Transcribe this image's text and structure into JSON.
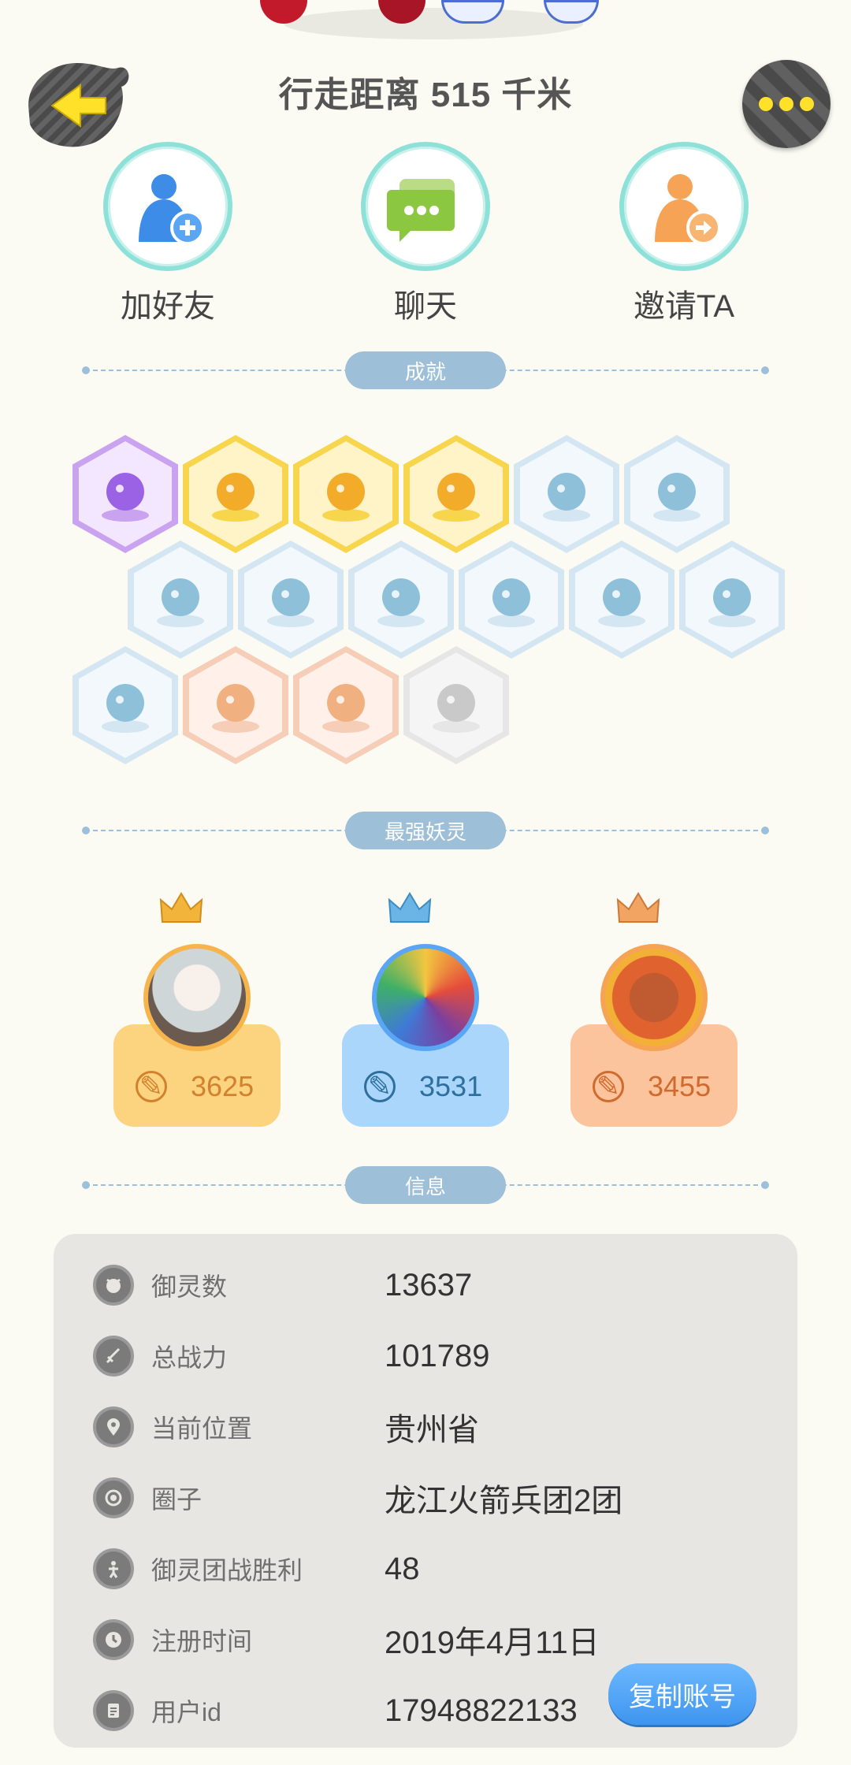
{
  "header": {
    "distance": "行走距离 515 千米",
    "back_icon": "back-arrow-icon",
    "more_icon": "more-icon"
  },
  "actions": [
    {
      "label": "加好友",
      "icon": "add-friend-icon",
      "accent": "#3d8de8"
    },
    {
      "label": "聊天",
      "icon": "chat-icon",
      "accent": "#8cc742"
    },
    {
      "label": "邀请TA",
      "icon": "invite-icon",
      "accent": "#f6a356"
    }
  ],
  "sections": {
    "achievements": "成就",
    "strongest": "最强妖灵",
    "info": "信息"
  },
  "achievements": [
    {
      "icon": "demon-face-icon",
      "tier": "purple"
    },
    {
      "icon": "sun-compass-icon",
      "tier": "gold"
    },
    {
      "icon": "golden-ball-icon",
      "tier": "gold"
    },
    {
      "icon": "coin-swirl-icon",
      "tier": "gold"
    },
    {
      "icon": "sneaker-icon",
      "tier": "blue"
    },
    {
      "icon": "moon-icon",
      "tier": "blue"
    },
    {
      "icon": "crystal-icon",
      "tier": "blue"
    },
    {
      "icon": "spirit-statue-icon",
      "tier": "blue"
    },
    {
      "icon": "cat-spirit-icon",
      "tier": "blue"
    },
    {
      "icon": "yin-yang-cube-icon",
      "tier": "blue"
    },
    {
      "icon": "fish-wave-icon",
      "tier": "blue"
    },
    {
      "icon": "target-scroll-icon",
      "tier": "blue"
    },
    {
      "icon": "hood-figure-icon",
      "tier": "blue"
    },
    {
      "icon": "cart-cat-icon",
      "tier": "bronze"
    },
    {
      "icon": "ox-spirit-icon",
      "tier": "bronze"
    },
    {
      "icon": "fox-book-icon",
      "tier": "gray"
    }
  ],
  "spirits": [
    {
      "power": "3625",
      "crown_color": "#f2b43a",
      "card_color": "#fcd37f",
      "text_color": "#d2822f",
      "avatar": "silver-hair-girl-avatar"
    },
    {
      "power": "3531",
      "crown_color": "#6ab4e6",
      "card_color": "#a9d6fa",
      "text_color": "#2f6f9e",
      "avatar": "prism-bird-avatar"
    },
    {
      "power": "3455",
      "crown_color": "#f2a462",
      "card_color": "#fcc49c",
      "text_color": "#d06a2e",
      "avatar": "fire-lion-avatar"
    }
  ],
  "info_rows": [
    {
      "key": "御灵数",
      "value": "13637",
      "icon": "spirit-count-icon"
    },
    {
      "key": "总战力",
      "value": "101789",
      "icon": "sword-icon"
    },
    {
      "key": "当前位置",
      "value": "贵州省",
      "icon": "location-pin-icon"
    },
    {
      "key": "圈子",
      "value": "龙江火箭兵团2团",
      "icon": "circle-target-icon"
    },
    {
      "key": "御灵团战胜利",
      "value": "48",
      "icon": "trophy-figure-icon"
    },
    {
      "key": "注册时间",
      "value": "2019年4月11日",
      "icon": "clock-icon"
    },
    {
      "key": "用户id",
      "value": "17948822133",
      "icon": "id-card-icon"
    }
  ],
  "copy_button": "复制账号"
}
